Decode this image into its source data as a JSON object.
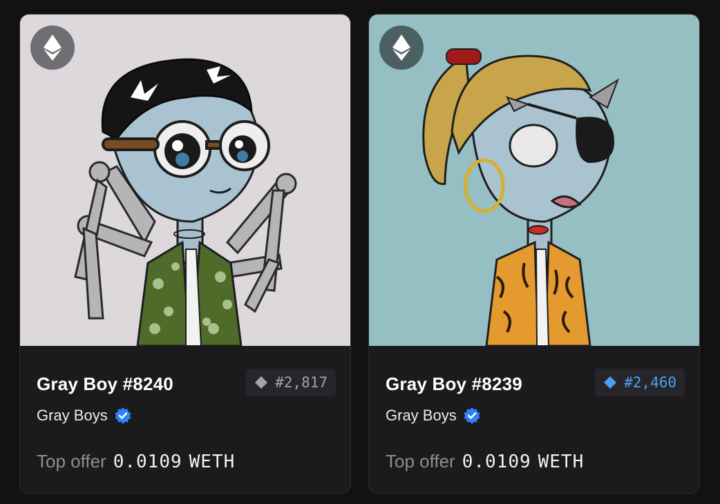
{
  "cards": [
    {
      "title": "Gray Boy #8240",
      "rank": "#2,817",
      "rank_color": "#a4a4a8",
      "collection": "Gray Boys",
      "offer_label": "Top offer",
      "offer_value": "0.0109",
      "offer_currency": "WETH",
      "background_color": "#dcd8dc",
      "chain_icon": "ethereum-icon",
      "verified_icon": "verified-badge-icon"
    },
    {
      "title": "Gray Boy #8239",
      "rank": "#2,460",
      "rank_color": "#4d9ef6",
      "collection": "Gray Boys",
      "offer_label": "Top offer",
      "offer_value": "0.0109",
      "offer_currency": "WETH",
      "background_color": "#95bfc3",
      "chain_icon": "ethereum-icon",
      "verified_icon": "verified-badge-icon"
    }
  ],
  "colors": {
    "page_background": "#121212",
    "card_background": "#1b1b1d",
    "verified_blue": "#2f81f7"
  }
}
